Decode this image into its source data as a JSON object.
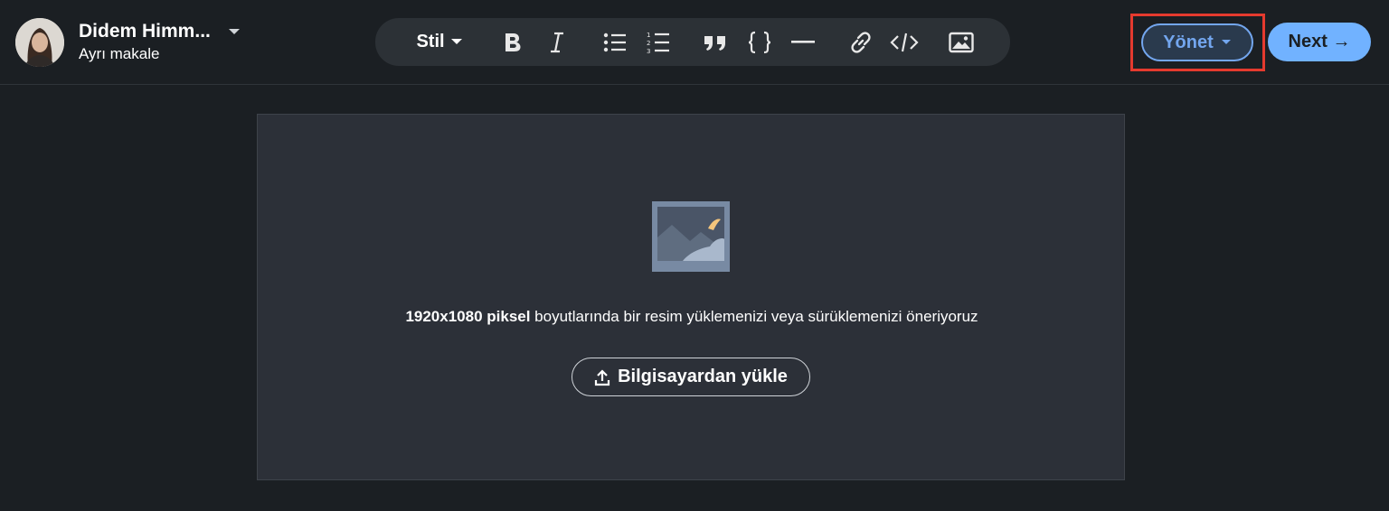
{
  "author": {
    "name": "Didem Himm...",
    "subtitle": "Ayrı makale"
  },
  "toolbar": {
    "style_label": "Stil",
    "icons": [
      "bold-icon",
      "italic-icon",
      "bulleted-list-icon",
      "numbered-list-icon",
      "quote-icon",
      "code-braces-icon",
      "divider-icon",
      "link-icon",
      "embed-code-icon",
      "image-icon"
    ]
  },
  "actions": {
    "manage_label": "Yönet",
    "next_label": "Next →"
  },
  "upload": {
    "hint_bold": "1920x1080 piksel",
    "hint_rest": " boyutlarında bir resim yüklemenizi veya sürüklemenizi öneriyoruz",
    "button_label": "Bilgisayardan yükle"
  },
  "colors": {
    "background": "#1b1f23",
    "toolbar": "#2c3136",
    "accent": "#71b2ff",
    "highlight": "#e53a2e"
  }
}
